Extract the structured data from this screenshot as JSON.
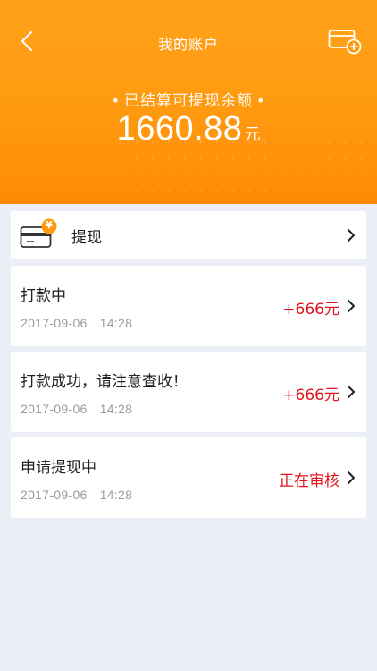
{
  "nav": {
    "title": "我的账户",
    "back_icon": "chevron-left-icon",
    "card_icon": "add-card-icon"
  },
  "balance": {
    "label": "已结算可提现余额",
    "amount": "1660.88",
    "unit": "元"
  },
  "withdraw": {
    "label": "提现",
    "icon": "wallet-yen-icon",
    "icon_badge": "¥"
  },
  "records": [
    {
      "title": "打款中",
      "date": "2017-09-06",
      "time": "14:28",
      "status": "+666元"
    },
    {
      "title": "打款成功，请注意查收！",
      "date": "2017-09-06",
      "time": "14:28",
      "status": "+666元"
    },
    {
      "title": "申请提现中",
      "date": "2017-09-06",
      "time": "14:28",
      "status": "正在审核"
    }
  ],
  "colors": {
    "header": "#ff9a10",
    "status": "#e2141e",
    "background": "#eceef8"
  }
}
